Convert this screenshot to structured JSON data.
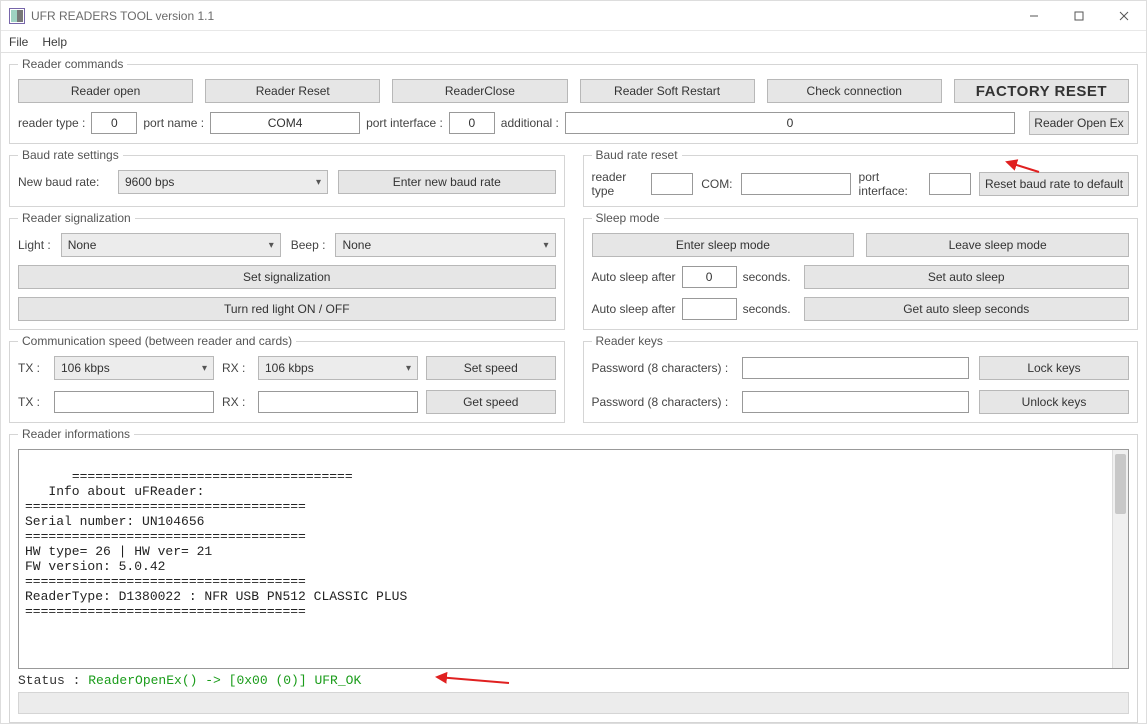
{
  "title": "UFR READERS TOOL version 1.1",
  "menu": {
    "file": "File",
    "help": "Help"
  },
  "reader_commands": {
    "legend": "Reader commands",
    "buttons": [
      "Reader open",
      "Reader Reset",
      "ReaderClose",
      "Reader Soft Restart",
      "Check connection"
    ],
    "factory": "FACTORY RESET",
    "labels": {
      "reader_type": "reader type :",
      "port_name": "port name :",
      "port_interface": "port interface :",
      "additional": "additional :"
    },
    "values": {
      "reader_type": "0",
      "port_name": "COM4",
      "port_interface": "0",
      "additional": "0"
    },
    "open_ex": "Reader Open Ex"
  },
  "baud_settings": {
    "legend": "Baud rate settings",
    "label_rate": "New baud rate:",
    "rate": "9600 bps",
    "btn": "Enter new baud rate"
  },
  "baud_reset": {
    "legend": "Baud rate reset",
    "labels": {
      "type": "reader type",
      "com": "COM:",
      "pif": "port interface:"
    },
    "values": {
      "type": "",
      "com": "",
      "pif": ""
    },
    "btn": "Reset baud rate to default"
  },
  "signalization": {
    "legend": "Reader signalization",
    "labels": {
      "light": "Light :",
      "beep": "Beep :"
    },
    "light": "None",
    "beep": "None",
    "btn_set": "Set signalization",
    "btn_red": "Turn red light ON / OFF"
  },
  "sleep": {
    "legend": "Sleep mode",
    "btn_enter": "Enter sleep mode",
    "btn_leave": "Leave sleep mode",
    "label_auto": "Auto sleep after",
    "label_seconds": "seconds.",
    "val_set": "0",
    "val_get": "",
    "btn_set": "Set auto sleep",
    "btn_get": "Get auto sleep seconds"
  },
  "speed": {
    "legend": "Communication speed (between reader and cards)",
    "label_tx": "TX :",
    "label_rx": "RX :",
    "tx": "106 kbps",
    "rx": "106 kbps",
    "tx2": "",
    "rx2": "",
    "btn_set": "Set speed",
    "btn_get": "Get speed"
  },
  "keys": {
    "legend": "Reader keys",
    "label_pw": "Password (8 characters) :",
    "pw_lock": "",
    "pw_unlock": "",
    "btn_lock": "Lock keys",
    "btn_unlock": "Unlock keys"
  },
  "infos": {
    "legend": "Reader informations",
    "log": "====================================\n   Info about uFReader:\n====================================\nSerial number: UN104656\n====================================\nHW type= 26 | HW ver= 21\nFW version: 5.0.42\n====================================\nReaderType: D1380022 : NFR USB PN512 CLASSIC PLUS\n====================================",
    "status_label": "Status : ",
    "status_text": "ReaderOpenEx() -> [0x00 (0)] UFR_OK"
  }
}
